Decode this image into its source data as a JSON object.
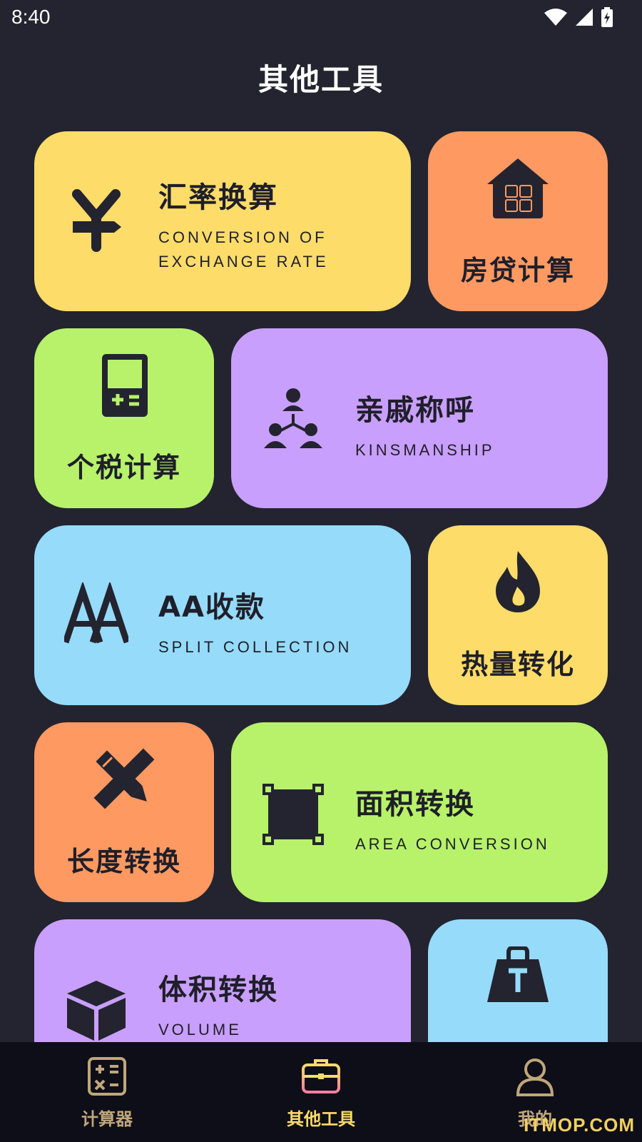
{
  "status": {
    "time": "8:40"
  },
  "page_title": "其他工具",
  "tools": [
    {
      "title": "汇率换算",
      "subtitle": "CONVERSION OF EXCHANGE RATE",
      "icon": "yen-icon",
      "color": "#fedc69"
    },
    {
      "title": "房贷计算",
      "icon": "house-calculator-icon",
      "color": "#fe9962"
    },
    {
      "title": "个税计算",
      "icon": "tax-calculator-icon",
      "color": "#b7f26a"
    },
    {
      "title": "亲戚称呼",
      "subtitle": "KINSMANSHIP",
      "icon": "family-tree-icon",
      "color": "#c99ffd"
    },
    {
      "title": "AA收款",
      "subtitle": "SPLIT COLLECTION",
      "icon": "aa-icon",
      "color": "#96dbfa"
    },
    {
      "title": "热量转化",
      "icon": "flame-icon",
      "color": "#fedc69"
    },
    {
      "title": "长度转换",
      "icon": "ruler-pencil-icon",
      "color": "#fe9962"
    },
    {
      "title": "面积转换",
      "subtitle": "AREA CONVERSION",
      "icon": "area-frame-icon",
      "color": "#b7f26a"
    },
    {
      "title": "体积转换",
      "subtitle": "VOLUME CONVERSION",
      "icon": "cube-icon",
      "color": "#c99ffd"
    },
    {
      "icon": "weight-icon",
      "color": "#96dbfa"
    }
  ],
  "nav": [
    {
      "label": "计算器",
      "icon": "calculator-icon"
    },
    {
      "label": "其他工具",
      "icon": "toolbox-icon",
      "active": true
    },
    {
      "label": "我的",
      "icon": "user-icon"
    }
  ],
  "watermark": "ITMOP.COM"
}
